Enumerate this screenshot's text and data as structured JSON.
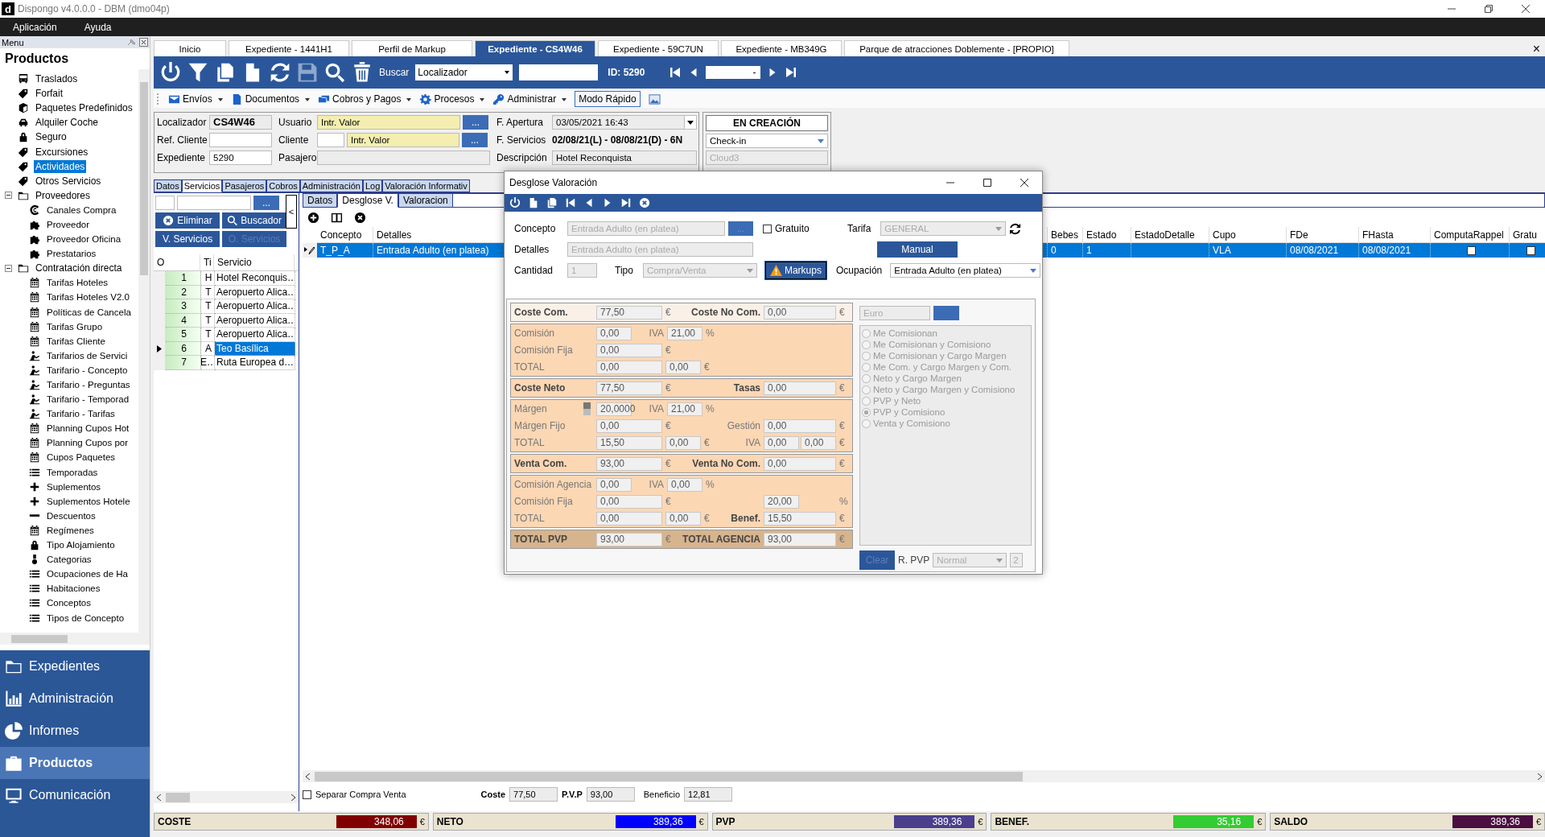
{
  "window": {
    "logo": "d",
    "title": "Dispongo v4.0.0.0 - DBM (dmo04p)"
  },
  "menu": [
    "Aplicación",
    "Ayuda"
  ],
  "sidebar": {
    "header": "Menu",
    "title": "Productos",
    "tree": [
      {
        "label": "Traslados",
        "kind": "bus",
        "selected": false
      },
      {
        "label": "Forfait",
        "kind": "tag",
        "selected": false
      },
      {
        "label": "Paquetes Predefinidos",
        "kind": "box",
        "selected": false
      },
      {
        "label": "Alquiler Coche",
        "kind": "car",
        "selected": false
      },
      {
        "label": "Seguro",
        "kind": "lock",
        "selected": false
      },
      {
        "label": "Excursiones",
        "kind": "tag",
        "selected": false
      },
      {
        "label": "Actividades",
        "kind": "tag",
        "selected": true
      },
      {
        "label": "Otros Servicios",
        "kind": "tag",
        "selected": false
      },
      {
        "label": "Proveedores",
        "kind": "folder",
        "selected": false,
        "expanded": true,
        "children": [
          {
            "label": "Canales Compra",
            "kind": "swirl",
            "selected": false
          },
          {
            "label": "Proveedor",
            "kind": "puzzle",
            "selected": false
          },
          {
            "label": "Proveedor Oficina",
            "kind": "puzzle",
            "selected": false
          },
          {
            "label": "Prestatarios",
            "kind": "puzzle",
            "selected": false
          }
        ]
      },
      {
        "label": "Contratación directa",
        "kind": "folder",
        "selected": false,
        "expanded": true,
        "children": [
          {
            "label": "Tarifas Hoteles",
            "kind": "calendar",
            "selected": false
          },
          {
            "label": "Tarifas Hoteles V2.0",
            "kind": "calendar",
            "selected": false
          },
          {
            "label": "Políticas de Cancela",
            "kind": "calendar",
            "selected": false
          },
          {
            "label": "Tarifas Grupo",
            "kind": "calendar",
            "selected": false
          },
          {
            "label": "Tarifas Cliente",
            "kind": "calendar",
            "selected": false
          },
          {
            "label": "Tarifarios de Servici",
            "kind": "person",
            "selected": false
          },
          {
            "label": "Tarifario - Concepto",
            "kind": "person",
            "selected": false
          },
          {
            "label": "Tarifario - Preguntas",
            "kind": "person",
            "selected": false
          },
          {
            "label": "Tarifario - Temporad",
            "kind": "person",
            "selected": false
          },
          {
            "label": "Tarifario - Tarifas",
            "kind": "person",
            "selected": false
          },
          {
            "label": "Planning Cupos Hot",
            "kind": "calendar",
            "selected": false
          },
          {
            "label": "Planning Cupos por",
            "kind": "calendar",
            "selected": false
          },
          {
            "label": "Cupos Paquetes",
            "kind": "calendar",
            "selected": false
          },
          {
            "label": "Temporadas",
            "kind": "list",
            "selected": false
          },
          {
            "label": "Suplementos",
            "kind": "plus",
            "selected": false
          },
          {
            "label": "Suplementos Hotele",
            "kind": "plus",
            "selected": false
          },
          {
            "label": "Descuentos",
            "kind": "minus",
            "selected": false
          },
          {
            "label": "Regímenes",
            "kind": "calendar",
            "selected": false
          },
          {
            "label": "Tipo Alojamiento",
            "kind": "lock",
            "selected": false
          },
          {
            "label": "Categorias",
            "kind": "medal",
            "selected": false
          },
          {
            "label": "Ocupaciones de Ha",
            "kind": "list",
            "selected": false
          },
          {
            "label": "Habitaciones",
            "kind": "list",
            "selected": false
          },
          {
            "label": "Conceptos",
            "kind": "list",
            "selected": false
          },
          {
            "label": "Tipos de Concepto",
            "kind": "list",
            "selected": false
          }
        ]
      }
    ],
    "nav": [
      {
        "label": "Expedientes",
        "kind": "folder",
        "selected": false
      },
      {
        "label": "Administración",
        "kind": "chart",
        "selected": false
      },
      {
        "label": "Informes",
        "kind": "pie",
        "selected": false
      },
      {
        "label": "Productos",
        "kind": "case",
        "selected": true
      },
      {
        "label": "Comunicación",
        "kind": "monitor",
        "selected": false
      }
    ]
  },
  "tabs": [
    {
      "label": "Inicio",
      "selected": false
    },
    {
      "label": "Expediente  - 1441H1",
      "selected": false
    },
    {
      "label": "Perfil de Markup",
      "selected": false
    },
    {
      "label": "Expediente  - CS4W46",
      "selected": true
    },
    {
      "label": "Expediente  - 59C7UN",
      "selected": false
    },
    {
      "label": "Expediente  - MB349G",
      "selected": false
    },
    {
      "label": "Parque de atracciones Doblemente - [PROPIO]",
      "selected": false
    }
  ],
  "tabs_close": "×",
  "toolbar": {
    "buttons": [
      {
        "kind": "power",
        "disabled": false
      },
      {
        "kind": "filter",
        "disabled": false
      },
      {
        "kind": "copy",
        "disabled": false
      },
      {
        "kind": "document",
        "disabled": false
      },
      {
        "kind": "refresh",
        "disabled": false
      },
      {
        "kind": "save",
        "disabled": true
      },
      {
        "kind": "search",
        "disabled": false
      },
      {
        "kind": "trash",
        "disabled": false
      }
    ],
    "search_label": "Buscar",
    "search_by": "Localizador",
    "id": "ID: 5290",
    "record": "-"
  },
  "actions": [
    {
      "label": "Envíos",
      "kind": "mail"
    },
    {
      "label": "Documentos",
      "kind": "pdf"
    },
    {
      "label": "Cobros y Pagos",
      "kind": "money"
    },
    {
      "label": "Procesos",
      "kind": "gear"
    },
    {
      "label": "Administrar",
      "kind": "key"
    }
  ],
  "quick_mode": "Modo Rápido",
  "header": {
    "localizador": {
      "label": "Localizador",
      "value": "CS4W46"
    },
    "ref_cliente": {
      "label": "Ref. Cliente"
    },
    "expediente": {
      "label": "Expediente",
      "value": "5290"
    },
    "usuario": {
      "label": "Usuario",
      "value": "Intr. Valor",
      "button": "..."
    },
    "cliente": {
      "label": "Cliente",
      "value": "Intr. Valor",
      "button": "..."
    },
    "pasajero": {
      "label": "Pasajero"
    },
    "apertura": {
      "label": "F. Apertura",
      "value": "03/05/2021 16:43"
    },
    "servicios": {
      "label": "F.  Servicios",
      "value": "02/08/21(L) - 08/08/21(D) - 6N"
    },
    "descripcion": {
      "label": "Descripción",
      "value": "Hotel Reconquista"
    },
    "status": "EN CREACIÓN",
    "stage": "Check-in",
    "cloud": "Cloud3"
  },
  "detail_tabs": [
    {
      "label": "Datos",
      "selected": false
    },
    {
      "label": "Servicios",
      "selected": true
    },
    {
      "label": "Pasajeros",
      "selected": false
    },
    {
      "label": "Cobros",
      "selected": false
    },
    {
      "label": "Administración",
      "selected": false
    },
    {
      "label": "Log",
      "selected": false
    },
    {
      "label": "Valoración Informativ",
      "selected": false
    }
  ],
  "services": {
    "more": "...",
    "collapse": "<",
    "buttons": [
      {
        "label": "Eliminar",
        "kind": "delete",
        "disabled": false
      },
      {
        "label": "Buscador",
        "kind": "search",
        "disabled": false
      },
      {
        "label": "V. Servicios",
        "kind": "none",
        "disabled": false
      },
      {
        "label": "O. Servicios",
        "kind": "none",
        "disabled": true
      }
    ],
    "columns": [
      "O",
      "Ti",
      "Servicio"
    ],
    "rows": [
      {
        "order": "1",
        "type": "H",
        "service": "Hotel Reconquis…",
        "selected": false
      },
      {
        "order": "2",
        "type": "T",
        "service": "Aeropuerto Alica…",
        "selected": false
      },
      {
        "order": "3",
        "type": "T",
        "service": "Aeropuerto Alica…",
        "selected": false
      },
      {
        "order": "4",
        "type": "T",
        "service": "Aeropuerto Alica…",
        "selected": false
      },
      {
        "order": "5",
        "type": "T",
        "service": "Aeropuerto Alica…",
        "selected": false
      },
      {
        "order": "6",
        "type": "A",
        "service": "Teo Basílica",
        "selected": true
      },
      {
        "order": "7",
        "type": "E…",
        "service": "Ruta Europea d…",
        "selected": false
      }
    ]
  },
  "sub_tabs": [
    {
      "label": "Datos",
      "selected": false
    },
    {
      "label": "Desglose V.",
      "selected": true
    },
    {
      "label": "Valoracion",
      "selected": false
    }
  ],
  "lines": {
    "columns": [
      "Concepto",
      "Detalles",
      "Bebes",
      "Estado",
      "EstadoDetalle",
      "Cupo",
      "FDe",
      "FHasta",
      "ComputaRappel",
      "Gratu"
    ],
    "rows": [
      {
        "selected": true,
        "cells": [
          "T_P_A",
          "Entrada Adulto (en platea)",
          "0",
          "1",
          "",
          "VLA",
          "08/08/2021",
          "08/08/2021"
        ],
        "computa_rappel": false,
        "gratuito": false
      }
    ]
  },
  "footer": {
    "separate": {
      "label": "Separar Compra Venta",
      "checked": false
    },
    "coste": {
      "label": "Coste",
      "value": "77,50"
    },
    "pvp": {
      "label": "P.V.P",
      "value": "93,00"
    },
    "beneficio": {
      "label": "Beneficio",
      "value": "12,81"
    }
  },
  "totals": [
    {
      "label": "COSTE",
      "value": "348,06",
      "color": "#800000",
      "currency": "€"
    },
    {
      "label": "NETO",
      "value": "389,36",
      "color": "#0000ff",
      "currency": "€"
    },
    {
      "label": "PVP",
      "value": "389,36",
      "color": "#4b3f8c",
      "currency": "€"
    },
    {
      "label": "BENEF.",
      "value": "35,16",
      "color": "#33cc33",
      "currency": "€"
    },
    {
      "label": "SALDO",
      "value": "389,36",
      "color": "#4a0f40",
      "currency": "€"
    }
  ],
  "dialog": {
    "title": "Desglose Valoración",
    "concepto": {
      "label": "Concepto",
      "value": "Entrada Adulto (en platea)",
      "button": "..."
    },
    "gratuito": {
      "label": "Gratuito",
      "checked": false
    },
    "tarifa": {
      "label": "Tarifa",
      "value": "GENERAL"
    },
    "manual": "Manual",
    "detalles": {
      "label": "Detalles",
      "value": "Entrada Adulto (en platea)"
    },
    "cantidad": {
      "label": "Cantidad",
      "value": "1"
    },
    "tipo": {
      "label": "Tipo",
      "value": "Compra/Venta"
    },
    "markups": "Markups",
    "ocupacion": {
      "label": "Ocupación",
      "value": "Entrada Adulto (en platea)"
    },
    "blocks": [
      {
        "color": "#fbf0e7",
        "rows": [
          {
            "left": [
              {
                "kind": "head",
                "text": "Coste Com."
              },
              {
                "kind": "field",
                "text": "77,50"
              },
              {
                "kind": "unit",
                "text": "€"
              }
            ],
            "right": {
              "label": "Coste No Com.",
              "bold": true,
              "fields": [
                "0,00"
              ],
              "unit": "€"
            }
          }
        ]
      },
      {
        "color": "#fcd7b4",
        "rows": [
          {
            "left": [
              {
                "kind": "label",
                "text": "Comisión"
              },
              {
                "kind": "short",
                "text": "0,00"
              },
              {
                "kind": "tag",
                "text": "IVA"
              },
              {
                "kind": "short",
                "text": "21,00"
              },
              {
                "kind": "unit",
                "text": "%"
              }
            ]
          },
          {
            "left": [
              {
                "kind": "label",
                "text": "Comisión Fija"
              },
              {
                "kind": "field",
                "text": "0,00"
              },
              {
                "kind": "unit",
                "text": "€"
              }
            ]
          },
          {
            "left": [
              {
                "kind": "label",
                "text": "TOTAL"
              },
              {
                "kind": "field",
                "text": "0,00"
              },
              {
                "kind": "short",
                "text": "0,00"
              },
              {
                "kind": "unit",
                "text": "€"
              }
            ]
          }
        ]
      },
      {
        "color": "#fcd7b4",
        "rows": [
          {
            "left": [
              {
                "kind": "head",
                "text": "Coste Neto"
              },
              {
                "kind": "field",
                "text": "77,50"
              },
              {
                "kind": "unit",
                "text": "€"
              }
            ],
            "right": {
              "label": "Tasas",
              "bold": true,
              "fields": [
                "0,00"
              ],
              "unit": "€"
            }
          }
        ]
      },
      {
        "color": "#fcd7b4",
        "rows": [
          {
            "left": [
              {
                "kind": "label",
                "text": "Márgen"
              },
              {
                "kind": "toggle"
              },
              {
                "kind": "short",
                "text": "20,0000"
              },
              {
                "kind": "tag",
                "text": "IVA"
              },
              {
                "kind": "short",
                "text": "21,00"
              },
              {
                "kind": "unit",
                "text": "%"
              }
            ]
          },
          {
            "left": [
              {
                "kind": "label",
                "text": "Márgen Fijo"
              },
              {
                "kind": "field",
                "text": "0,00"
              },
              {
                "kind": "unit",
                "text": "€"
              }
            ],
            "right": {
              "label": "Gestión",
              "bold": false,
              "fields": [
                "0,00"
              ],
              "unit": "€"
            }
          },
          {
            "left": [
              {
                "kind": "label",
                "text": "TOTAL"
              },
              {
                "kind": "field",
                "text": "15,50"
              },
              {
                "kind": "short",
                "text": "0,00"
              },
              {
                "kind": "unit",
                "text": "€"
              }
            ],
            "right": {
              "label": "IVA",
              "bold": false,
              "fields": [
                "0,00",
                "0,00"
              ],
              "unit": "€"
            }
          }
        ]
      },
      {
        "color": "#fcd7b4",
        "rows": [
          {
            "left": [
              {
                "kind": "head",
                "text": "Venta Com."
              },
              {
                "kind": "field",
                "text": "93,00"
              },
              {
                "kind": "unit",
                "text": "€"
              }
            ],
            "right": {
              "label": "Venta No Com.",
              "bold": true,
              "fields": [
                "0,00"
              ],
              "unit": "€"
            }
          }
        ]
      },
      {
        "color": "#fcd7b4",
        "rows": [
          {
            "left": [
              {
                "kind": "label",
                "text": "Comisión Agencia"
              },
              {
                "kind": "short",
                "text": "0,00"
              },
              {
                "kind": "tag",
                "text": "IVA"
              },
              {
                "kind": "short",
                "text": "0,00"
              },
              {
                "kind": "unit",
                "text": "%"
              }
            ]
          },
          {
            "left": [
              {
                "kind": "label",
                "text": "Comisión Fija"
              },
              {
                "kind": "field",
                "text": "0,00"
              },
              {
                "kind": "unit",
                "text": "€"
              }
            ],
            "right": {
              "fields": [
                "20,00"
              ],
              "unit": "%"
            }
          },
          {
            "left": [
              {
                "kind": "label",
                "text": "TOTAL"
              },
              {
                "kind": "field",
                "text": "0,00"
              },
              {
                "kind": "short",
                "text": "0,00"
              },
              {
                "kind": "unit",
                "text": "€"
              }
            ],
            "right": {
              "label": "Benef.",
              "bold": true,
              "fields": [
                "15,50"
              ],
              "unit": "€"
            }
          }
        ]
      },
      {
        "color": "#d6b48e",
        "rows": [
          {
            "left": [
              {
                "kind": "head",
                "text": "TOTAL PVP"
              },
              {
                "kind": "field",
                "text": "93,00"
              },
              {
                "kind": "unit",
                "text": "€"
              }
            ],
            "right": {
              "label": "TOTAL AGENCIA",
              "bold": true,
              "fields": [
                "93,00"
              ],
              "unit": "€"
            }
          }
        ]
      }
    ],
    "currency": "Euro",
    "modes": [
      {
        "label": "Me Comisionan",
        "selected": false
      },
      {
        "label": "Me Comisionan y Comisiono",
        "selected": false
      },
      {
        "label": "Me Comisionan y Cargo Margen",
        "selected": false
      },
      {
        "label": "Me Com. y Cargo Margen y Com.",
        "selected": false
      },
      {
        "label": "Neto y Cargo Margen",
        "selected": false
      },
      {
        "label": "Neto y Cargo Margen y Comisiono",
        "selected": false
      },
      {
        "label": "PVP y Neto",
        "selected": false
      },
      {
        "label": "PVP y Comisiono",
        "selected": true
      },
      {
        "label": "Venta y Comisiono",
        "selected": false
      }
    ],
    "clear": "Clear",
    "rpvp": {
      "label": "R. PVP",
      "value": "Normal",
      "count": "2"
    }
  }
}
